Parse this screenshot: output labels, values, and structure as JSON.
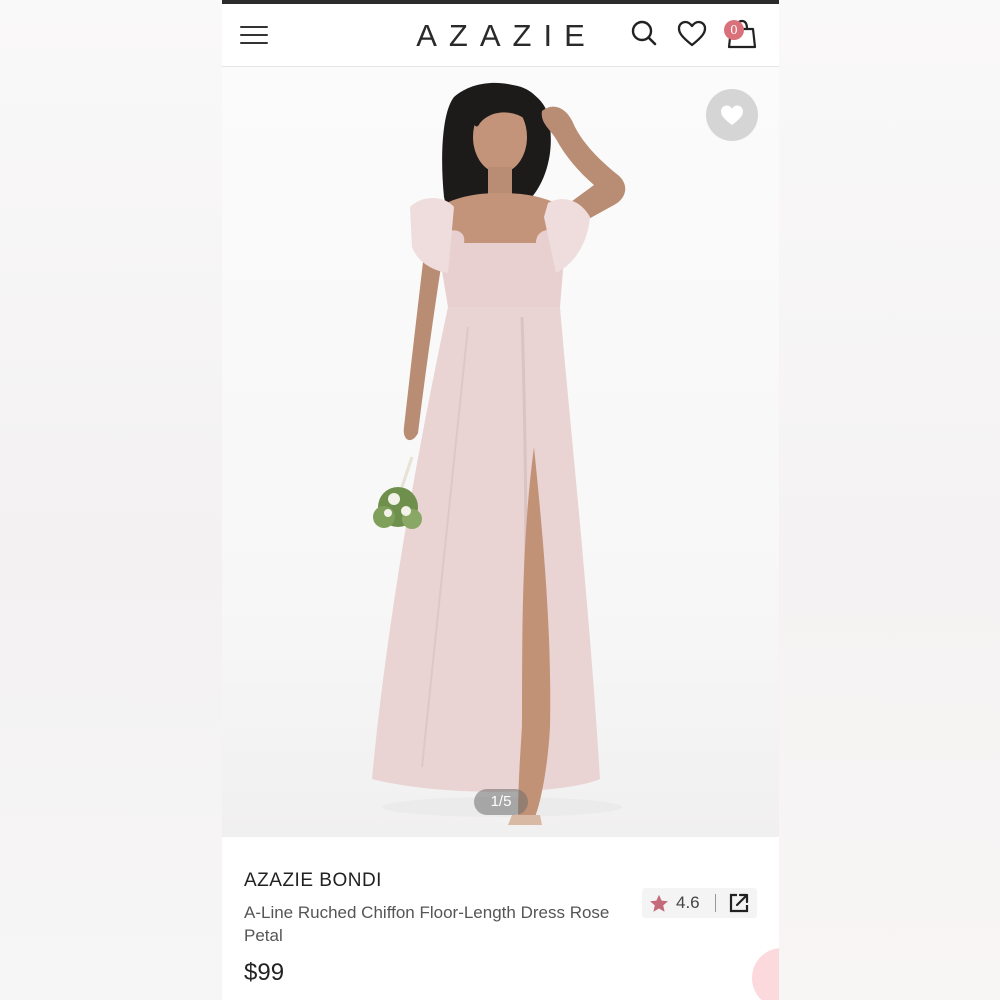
{
  "header": {
    "logo": "AZAZIE",
    "cart_count": "0"
  },
  "icons": {
    "menu": "hamburger-menu-icon",
    "search": "search-icon",
    "wishlist": "heart-icon",
    "cart": "shopping-bag-icon",
    "favorite": "heart-filled-icon",
    "rating_star": "star-icon",
    "share": "share-external-icon"
  },
  "gallery": {
    "pager": "1/5"
  },
  "product": {
    "brand": "AZAZIE BONDI",
    "name": "A-Line Ruched Chiffon Floor-Length Dress Rose Petal",
    "price": "$99",
    "rating": "4.6"
  },
  "colors": {
    "accent": "#d9707a",
    "dress": "#e9d3d3",
    "text_dark": "#222222"
  }
}
